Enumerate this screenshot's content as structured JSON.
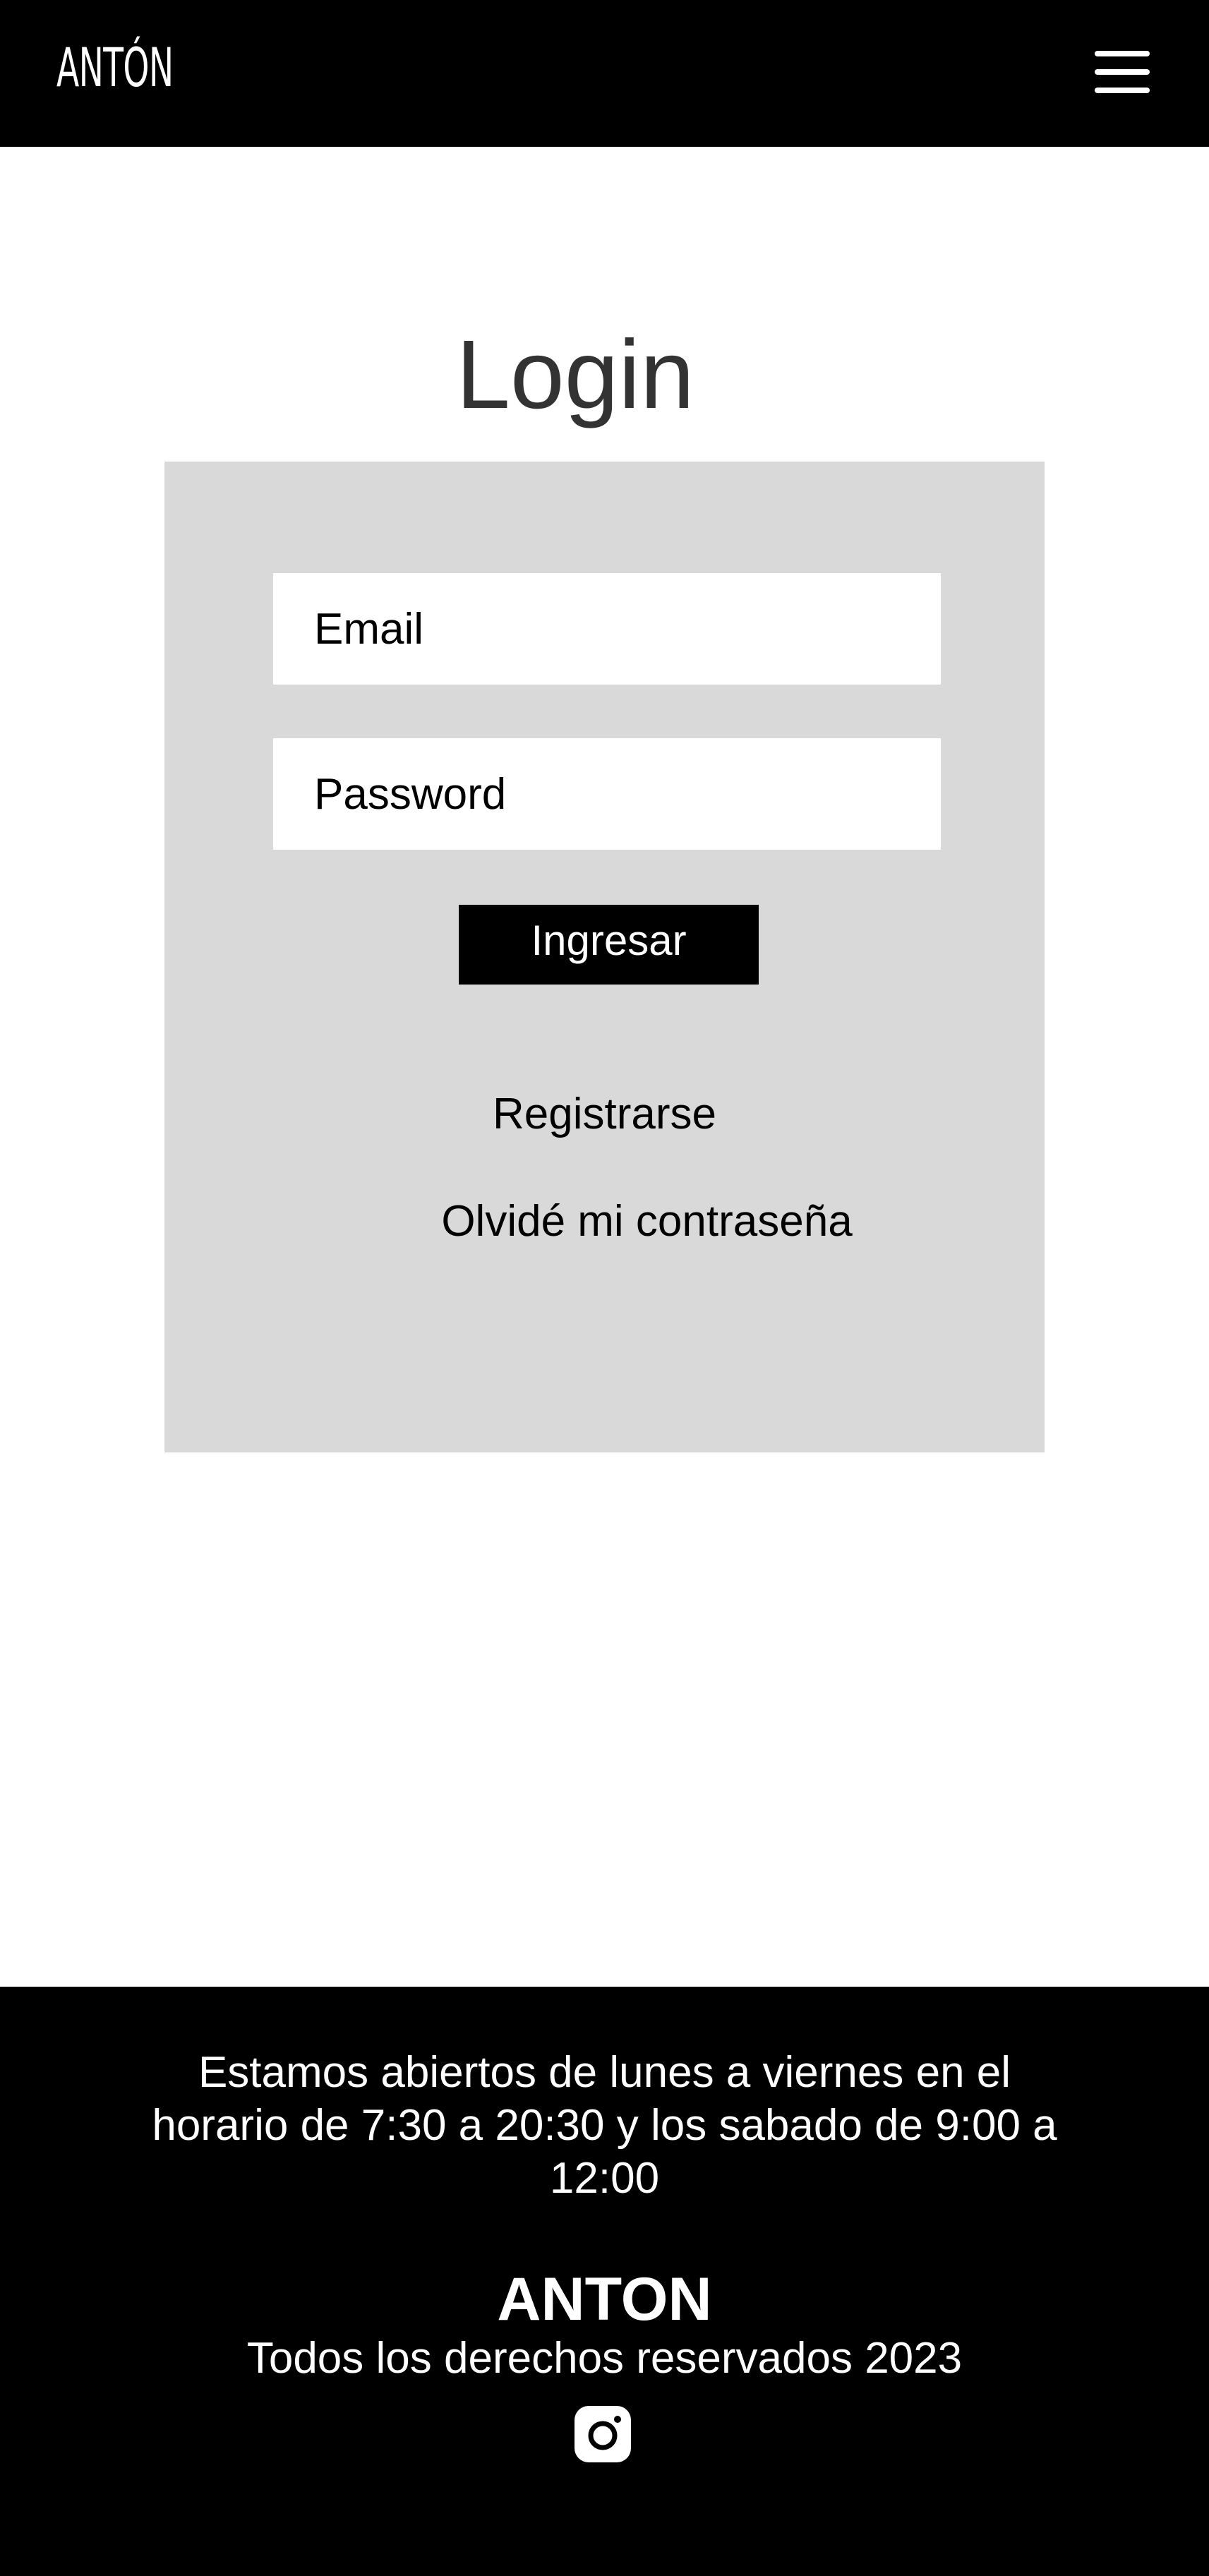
{
  "header": {
    "logo_text": "ANTÓN",
    "menu_icon": "hamburger-menu-icon"
  },
  "login": {
    "title": "Login",
    "email_placeholder": "Email",
    "password_placeholder": "Password",
    "submit_label": "Ingresar",
    "register_link": "Registrarse",
    "forgot_link": "Olvidé mi contraseña"
  },
  "footer": {
    "hours": "Estamos abiertos de lunes a viernes en el horario de 7:30 a 20:30 y los sabado de 9:00 a 12:00",
    "brand": "ANTON",
    "rights": "Todos los derechos reservados 2023",
    "social_icon": "instagram-icon"
  },
  "colors": {
    "header_bg": "#000000",
    "card_bg": "#d9d9d9",
    "button_bg": "#000000",
    "title_text": "#333333"
  }
}
